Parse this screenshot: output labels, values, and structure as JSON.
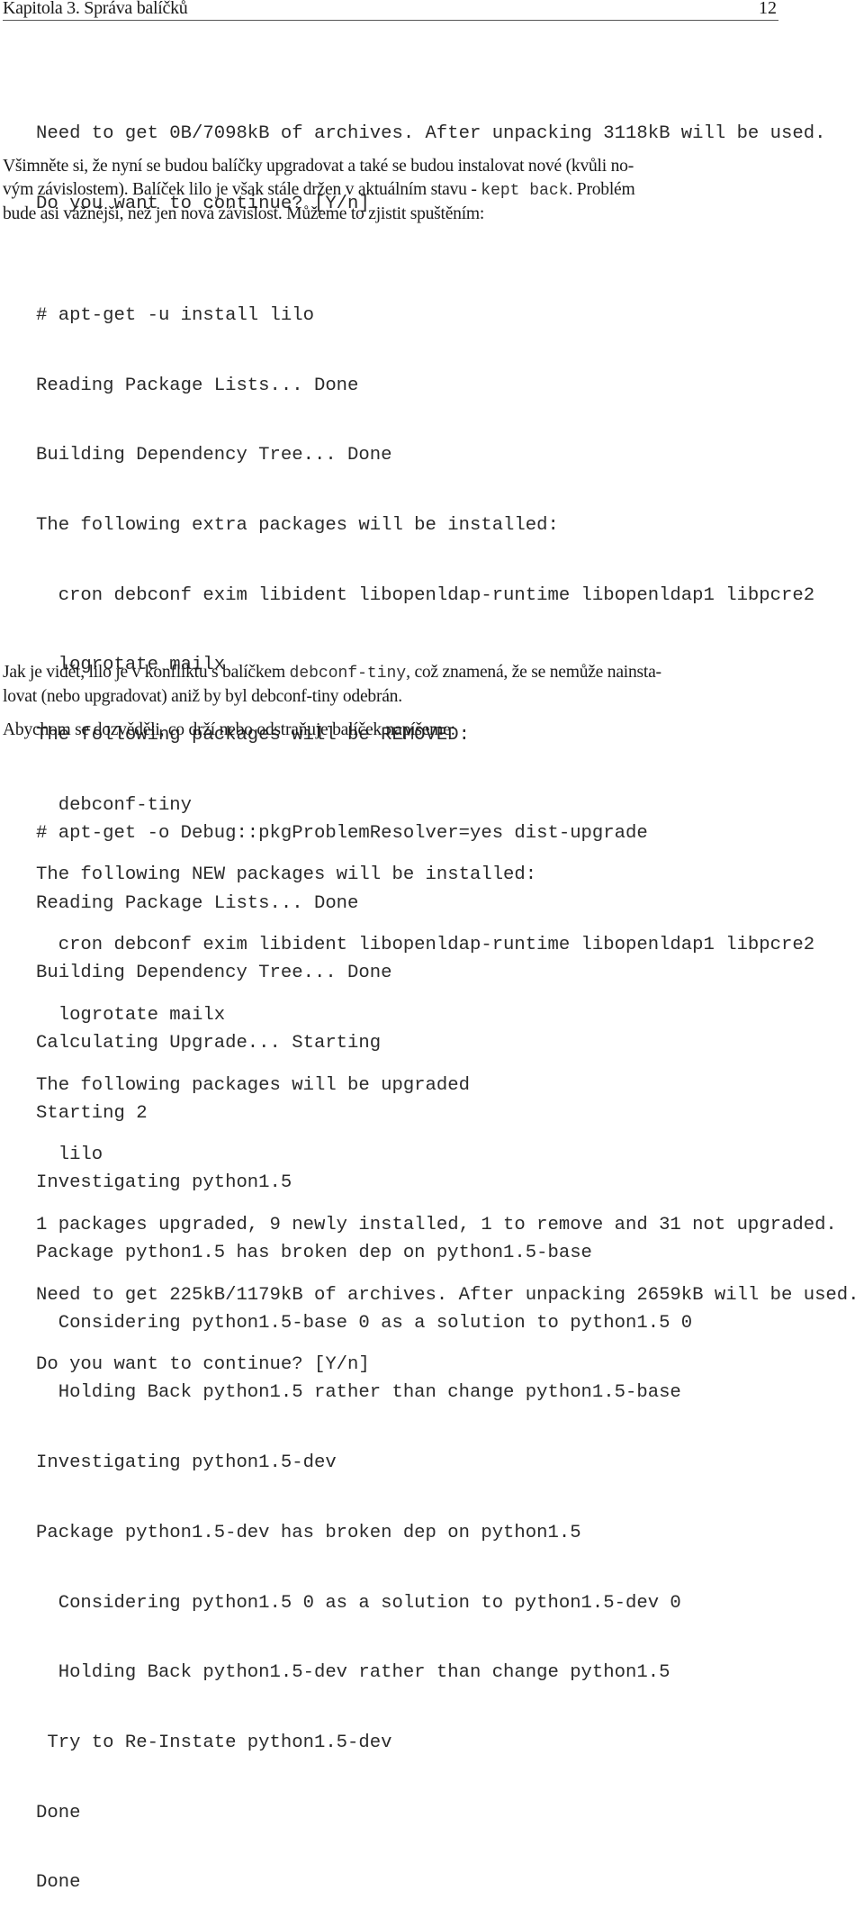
{
  "header": {
    "chapter_title": "Kapitola 3. Správa balíčků",
    "page_number": "12"
  },
  "block1": {
    "lines": [
      "Need to get 0B/7098kB of archives. After unpacking 3118kB will be used.",
      "Do you want to continue? [Y/n]"
    ]
  },
  "para1": {
    "line1": "Všimněte si, že nyní se budou balíčky upgradovat a také se budou instalovat nové (kvůli no-",
    "line2_a": "vým závislostem). Balíček lilo je však stále držen v aktuálním stavu - ",
    "line2_code": "kept back",
    "line2_b": ". Problém",
    "line3": "bude asi vážnější, než jen nová závislost. Můžeme to zjistit spuštěním:"
  },
  "block2": {
    "lines": [
      "# apt-get -u install lilo",
      "Reading Package Lists... Done",
      "Building Dependency Tree... Done",
      "The following extra packages will be installed:",
      "  cron debconf exim libident libopenldap-runtime libopenldap1 libpcre2",
      "  logrotate mailx",
      "The following packages will be REMOVED:",
      "  debconf-tiny",
      "The following NEW packages will be installed:",
      "  cron debconf exim libident libopenldap-runtime libopenldap1 libpcre2",
      "  logrotate mailx",
      "The following packages will be upgraded",
      "  lilo",
      "1 packages upgraded, 9 newly installed, 1 to remove and 31 not upgraded.",
      "Need to get 225kB/1179kB of archives. After unpacking 2659kB will be used.",
      "Do you want to continue? [Y/n]"
    ]
  },
  "para2": {
    "line1_a": "Jak je vidět, lilo je v konfliktu s balíčkem ",
    "line1_code": "debconf-tiny",
    "line1_b": ", což znamená, že se nemůže nainsta-",
    "line2": "lovat (nebo upgradovat) aniž by byl debconf-tiny odebrán."
  },
  "para3": {
    "line1": "Abychom se dozvěděli, co drží nebo odstraňuje balíček napíšeme:"
  },
  "block3": {
    "lines": [
      "# apt-get -o Debug::pkgProblemResolver=yes dist-upgrade",
      "Reading Package Lists... Done",
      "Building Dependency Tree... Done",
      "Calculating Upgrade... Starting",
      "Starting 2",
      "Investigating python1.5",
      "Package python1.5 has broken dep on python1.5-base",
      "  Considering python1.5-base 0 as a solution to python1.5 0",
      "  Holding Back python1.5 rather than change python1.5-base",
      "Investigating python1.5-dev",
      "Package python1.5-dev has broken dep on python1.5",
      "  Considering python1.5 0 as a solution to python1.5-dev 0",
      "  Holding Back python1.5-dev rather than change python1.5",
      " Try to Re-Instate python1.5-dev",
      "Done",
      "Done"
    ]
  }
}
